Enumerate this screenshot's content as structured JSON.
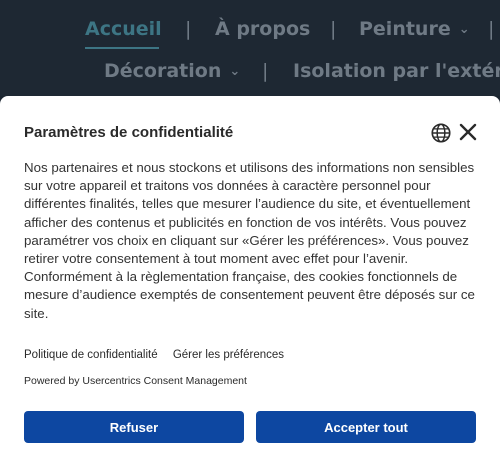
{
  "nav": {
    "row1": [
      {
        "label": "Accueil",
        "active": true
      },
      {
        "label": "À propos"
      },
      {
        "label": "Peinture",
        "dropdown": true
      }
    ],
    "row2": [
      {
        "label": "Décoration",
        "dropdown": true
      },
      {
        "label": "Isolation par l'extérie"
      }
    ],
    "separator": "|"
  },
  "dialog": {
    "title": "Paramètres de confidentialité",
    "icons": [
      "globe-icon",
      "close-icon"
    ],
    "body": "Nos partenaires et nous stockons et utilisons des informations non sensibles sur votre appareil et traitons vos données à caractère personnel pour différentes finalités, telles que mesurer l’audience du site, et éventuellement afficher des contenus et publicités en fonction de vos intérêts. Vous pouvez paramétrer vos choix en cliquant sur «Gérer les préférences». Vous pouvez retirer votre consentement à tout moment avec effet pour l’avenir. Conformément à la règlementation française, des cookies fonctionnels de mesure d’audience exemptés de consentement peuvent être déposés sur ce site.",
    "links": {
      "privacy": "Politique de confidentialité",
      "manage": "Gérer les préférences"
    },
    "powered_by": "Powered by Usercentrics Consent Management",
    "buttons": {
      "refuse": "Refuser",
      "accept": "Accepter tout"
    },
    "colors": {
      "button": "#0d47a1",
      "nav_active": "#3d7584"
    }
  }
}
